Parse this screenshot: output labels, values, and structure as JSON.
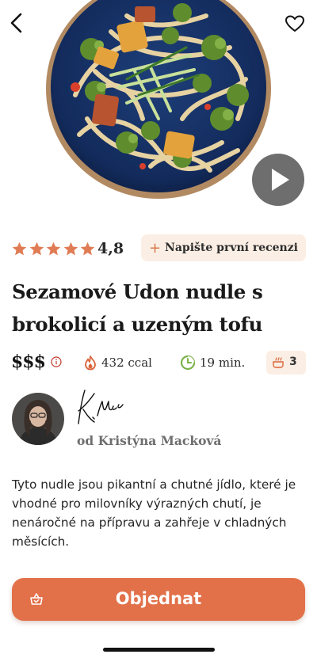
{
  "colors": {
    "accent": "#e2714a",
    "accent_light": "#fbeee4",
    "star": "#e07c55",
    "time_green": "#7db34a",
    "text_dark": "#1a1a1a",
    "text_muted": "#6e6e6e"
  },
  "header": {
    "back_icon": "chevron-left-icon",
    "favorite_icon": "heart-icon",
    "play_icon": "play-icon"
  },
  "rating": {
    "stars_filled": 5,
    "stars_total": 5,
    "value": "4,8",
    "review_button_plus": "+",
    "review_button_label": "Napište první recenzi"
  },
  "recipe": {
    "title": "Sezamové Udon nudle s brokolicí  a uzeným tofu",
    "price_level": "$$$",
    "calories": "432 ccal",
    "time": "19 min.",
    "portions": "3",
    "description": "Tyto nudle jsou pikantní a chutné jídlo, které je vhodné pro milovníky výrazných chutí, je nenáročné na přípravu a zahřeje v chladných měsících."
  },
  "author": {
    "name": "od Kristýna Macková",
    "signature_text": "K. Mac"
  },
  "order": {
    "label": "Objednat",
    "icon": "basket-icon"
  }
}
